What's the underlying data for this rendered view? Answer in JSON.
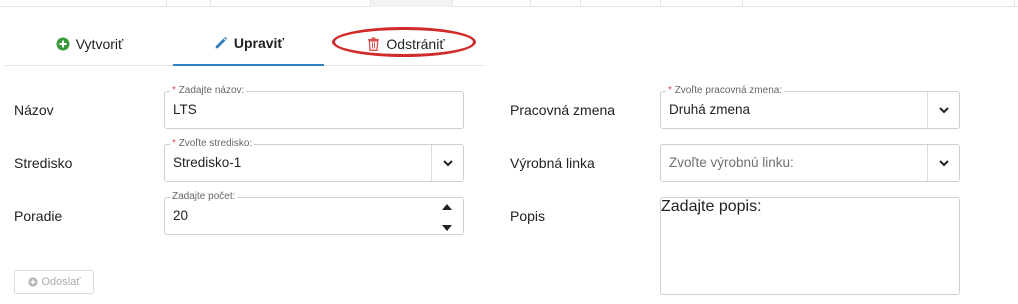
{
  "tabs": {
    "create_label": "Vytvoriť",
    "edit_label": "Upraviť",
    "delete_label": "Odstrániť"
  },
  "form": {
    "name": {
      "label": "Názov",
      "floating_label": "Zadajte názov:",
      "required_mark": "*",
      "value": "LTS"
    },
    "center": {
      "label": "Stredisko",
      "floating_label": "Zvoľte stredisko:",
      "required_mark": "*",
      "value": "Stredisko-1"
    },
    "order": {
      "label": "Poradie",
      "floating_label": "Zadajte počet:",
      "value": "20"
    },
    "shift": {
      "label": "Pracovná zmena",
      "floating_label": "Zvoľte pracovná zmena:",
      "required_mark": "*",
      "value": "Druhá zmena"
    },
    "line": {
      "label": "Výrobná linka",
      "placeholder": "Zvoľte výrobnú linku:"
    },
    "description": {
      "label": "Popis",
      "placeholder": "Zadajte popis:"
    }
  },
  "submit_label": "Odoslať",
  "colors": {
    "create_icon": "#3a9a3a",
    "edit_icon": "#2f80c0",
    "delete_icon": "#d9534f",
    "delete_highlight": "#d02a2a",
    "active_tab_underline": "#2f80c0"
  }
}
